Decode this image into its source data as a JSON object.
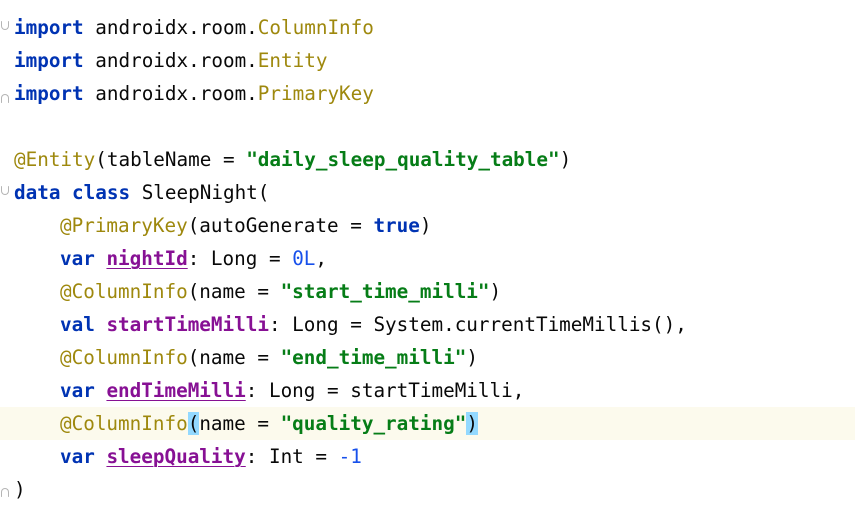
{
  "imports": [
    {
      "kw": "import",
      "pkg": "androidx.room.",
      "name": "ColumnInfo"
    },
    {
      "kw": "import",
      "pkg": "androidx.room.",
      "name": "Entity"
    },
    {
      "kw": "import",
      "pkg": "androidx.room.",
      "name": "PrimaryKey"
    }
  ],
  "entity": {
    "annotation": "@Entity",
    "open": "(tableName = ",
    "table": "\"daily_sleep_quality_table\"",
    "close": ")"
  },
  "cls": {
    "kw1": "data",
    "kw2": "class",
    "name": " SleepNight(",
    "close": ")"
  },
  "lines": {
    "pk_ann": "@PrimaryKey",
    "pk_args": "(autoGenerate = ",
    "pk_true": "true",
    "pk_close": ")",
    "v1_kw": "var",
    "v1_name": "nightId",
    "v1_type": ": Long = ",
    "v1_val": "0L",
    "v1_end": ",",
    "c1_ann": "@ColumnInfo",
    "c1_args": "(name = ",
    "c1_str": "\"start_time_milli\"",
    "c1_close": ")",
    "v2_kw": "val",
    "v2_name": "startTimeMilli",
    "v2_rest": ": Long = System.currentTimeMillis(),",
    "c2_ann": "@ColumnInfo",
    "c2_args": "(name = ",
    "c2_str": "\"end_time_milli\"",
    "c2_close": ")",
    "v3_kw": "var",
    "v3_name": "endTimeMilli",
    "v3_rest": ": Long = startTimeMilli,",
    "c3_ann": "@ColumnInfo",
    "c3_open": "(",
    "c3_args": "name = ",
    "c3_str": "\"quality_rating\"",
    "c3_close": ")",
    "v4_kw": "var",
    "v4_name": "sleepQuality",
    "v4_type": ": Int = ",
    "v4_val": "-1"
  }
}
